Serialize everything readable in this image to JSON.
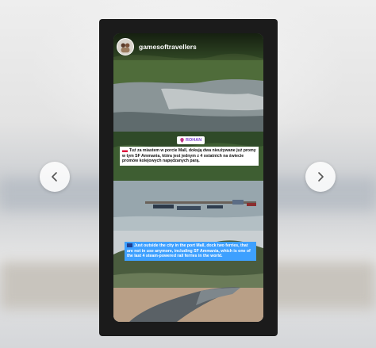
{
  "story": {
    "username": "gamesoftravellers",
    "location_label": "ROHAN",
    "caption_pl": "Tuż za miastem w porcie Mall, dokują dwa nieużywane już promy w tym SF Ammania, która jest jednym z 4 ostatnich na świecie promów kolejowych napędzanych parą.",
    "caption_en": "Just outside the city in the port Mall, dock two ferries, that are not in use anymore, including SF Ammania, which is one of the last 4 steam-powered rail ferries in the world."
  },
  "navigation": {
    "prev_icon": "chevron-left-icon",
    "next_icon": "chevron-right-icon"
  },
  "colors": {
    "caption_en_bg": "#3ea0ff",
    "location_text": "#7a3fd1"
  }
}
